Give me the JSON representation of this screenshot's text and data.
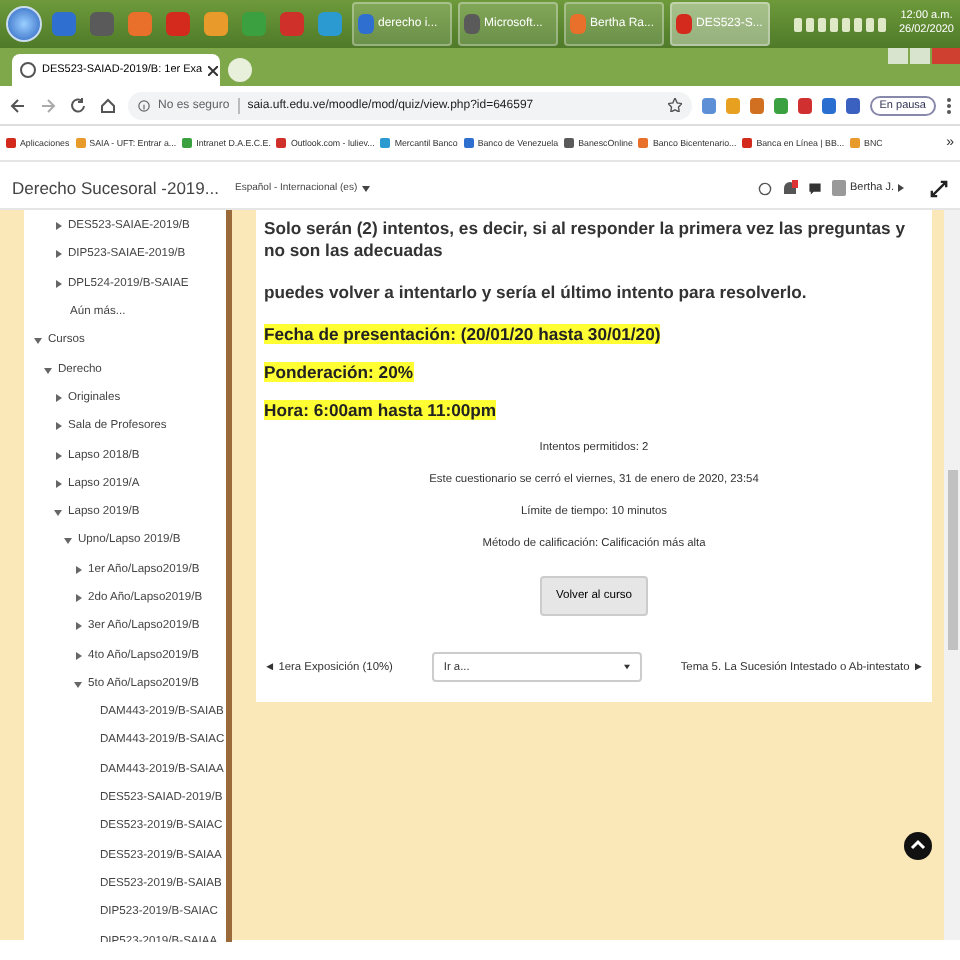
{
  "taskbar": {
    "tasks": [
      {
        "label": "derecho i...",
        "selected": false
      },
      {
        "label": "Microsoft...",
        "selected": false
      },
      {
        "label": "Bertha Ra...",
        "selected": false
      },
      {
        "label": "DES523-S...",
        "selected": true
      }
    ],
    "clock": {
      "time": "12:00 a.m.",
      "date": "26/02/2020"
    }
  },
  "browser": {
    "tab": {
      "title": "DES523-SAIAD-2019/B: 1er Exa",
      "selected": true
    },
    "address": {
      "security": "No es seguro",
      "url": "saia.uft.edu.ve/moodle/mod/quiz/view.php?id=646597"
    },
    "profile": "En pausa",
    "bookmarks": [
      "Aplicaciones",
      "SAIA - UFT: Entrar a...",
      "Intranet D.A.E.C.E.",
      "Outlook.com - luliev...",
      "Mercantil Banco",
      "Banco de Venezuela",
      "BanescOnline",
      "Banco Bicentenario...",
      "Banca en Línea | BB...",
      "BNC"
    ],
    "bookmarks_more": "»"
  },
  "header": {
    "course": "Derecho Sucesoral -2019...",
    "language": "Español - Internacional (es)",
    "user": "Bertha J."
  },
  "sidebar": {
    "upper_items": [
      {
        "label": "DES523-SAIAE-2019/B",
        "expanded": false
      },
      {
        "label": "DIP523-SAIAE-2019/B",
        "expanded": false
      },
      {
        "label": "DPL524-2019/B-SAIAE",
        "expanded": false
      },
      {
        "label": "Aún más..."
      }
    ],
    "tree": [
      {
        "label": "Cursos",
        "expanded": true,
        "children": [
          {
            "label": "Derecho",
            "expanded": true,
            "children": [
              {
                "label": "Originales",
                "expanded": false
              },
              {
                "label": "Sala de Profesores",
                "expanded": false
              },
              {
                "label": "Lapso 2018/B",
                "expanded": false
              },
              {
                "label": "Lapso 2019/A",
                "expanded": false
              },
              {
                "label": "Lapso 2019/B",
                "expanded": true,
                "children": [
                  {
                    "label": "Upno/Lapso 2019/B",
                    "expanded": true,
                    "children": [
                      {
                        "label": "1er Año/Lapso2019/B",
                        "expanded": false
                      },
                      {
                        "label": "2do Año/Lapso2019/B",
                        "expanded": false
                      },
                      {
                        "label": "3er Año/Lapso2019/B",
                        "expanded": false
                      },
                      {
                        "label": "4to Año/Lapso2019/B",
                        "expanded": false
                      },
                      {
                        "label": "5to Año/Lapso2019/B",
                        "expanded": true,
                        "children": [
                          {
                            "label": "DAM443-2019/B-SAIAB"
                          },
                          {
                            "label": "DAM443-2019/B-SAIAC"
                          },
                          {
                            "label": "DAM443-2019/B-SAIAA"
                          },
                          {
                            "label": "DES523-SAIAD-2019/B"
                          },
                          {
                            "label": "DES523-2019/B-SAIAC"
                          },
                          {
                            "label": "DES523-2019/B-SAIAA"
                          },
                          {
                            "label": "DES523-2019/B-SAIAB"
                          },
                          {
                            "label": "DIP523-2019/B-SAIAC"
                          },
                          {
                            "label": "DIP523-2019/B-SAIAA"
                          }
                        ]
                      }
                    ]
                  }
                ]
              }
            ]
          }
        ]
      }
    ]
  },
  "content": {
    "paragraphs": [
      {
        "text": "Solo serán (2) intentos, es  decir, si al responder la primera vez las preguntas y no son las adecuadas",
        "highlight": false
      },
      {
        "text": "puedes volver a intentarlo y sería el último intento para resolverlo.",
        "highlight": false
      },
      {
        "text": "Fecha de presentación: (20/01/20 hasta 30/01/20)",
        "highlight": true
      },
      {
        "text": "Ponderación: 20%",
        "highlight": true
      },
      {
        "text": "Hora: 6:00am hasta 11:00pm",
        "highlight": true
      }
    ],
    "info": [
      "Intentos permitidos: 2",
      "Este cuestionario se cerró el viernes, 31 de enero de 2020, 23:54",
      "Límite de tiempo: 10 minutos",
      "Método de calificación: Calificación más alta"
    ],
    "back_button": "Volver al curso",
    "nav": {
      "previous": "◄ 1era Exposición (10%)",
      "jump": {
        "placeholder": "Ir a..."
      },
      "next": "Tema 5. La Sucesión Intestado o Ab-intestato ►"
    }
  }
}
